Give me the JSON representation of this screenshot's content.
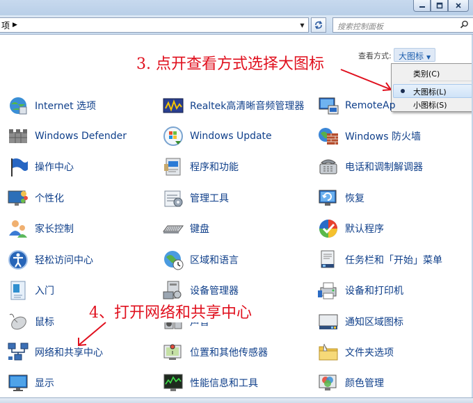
{
  "address": {
    "text": "项"
  },
  "search": {
    "placeholder": "搜索控制面板"
  },
  "view": {
    "label": "查看方式:",
    "value": "大图标"
  },
  "menu": {
    "items": [
      "类别(C)",
      "大图标(L)",
      "小图标(S)"
    ],
    "selected": "大图标(L)"
  },
  "annotations": {
    "step3": "3. 点开查看方式选择大图标",
    "step4": "4、打开网络和共享中心"
  },
  "items": [
    {
      "label": "Internet 选项",
      "icon": "internet-options-icon"
    },
    {
      "label": "Realtek高清晰音频管理器",
      "icon": "realtek-audio-icon"
    },
    {
      "label": "RemoteAp",
      "icon": "remoteapp-icon"
    },
    {
      "label": "Windows Defender",
      "icon": "windows-defender-icon"
    },
    {
      "label": "Windows Update",
      "icon": "windows-update-icon"
    },
    {
      "label": "Windows 防火墙",
      "icon": "firewall-icon"
    },
    {
      "label": "操作中心",
      "icon": "action-center-flag-icon"
    },
    {
      "label": "程序和功能",
      "icon": "programs-icon"
    },
    {
      "label": "电话和调制解调器",
      "icon": "phone-modem-icon"
    },
    {
      "label": "个性化",
      "icon": "personalization-icon"
    },
    {
      "label": "管理工具",
      "icon": "admin-tools-icon"
    },
    {
      "label": "恢复",
      "icon": "recovery-icon"
    },
    {
      "label": "家长控制",
      "icon": "parental-controls-icon"
    },
    {
      "label": "键盘",
      "icon": "keyboard-icon"
    },
    {
      "label": "默认程序",
      "icon": "default-programs-icon"
    },
    {
      "label": "轻松访问中心",
      "icon": "ease-of-access-icon"
    },
    {
      "label": "区域和语言",
      "icon": "region-language-icon"
    },
    {
      "label": "任务栏和「开始」菜单",
      "icon": "taskbar-icon"
    },
    {
      "label": "入门",
      "icon": "getting-started-icon"
    },
    {
      "label": "设备管理器",
      "icon": "device-manager-icon"
    },
    {
      "label": "设备和打印机",
      "icon": "devices-printers-icon"
    },
    {
      "label": "鼠标",
      "icon": "mouse-icon"
    },
    {
      "label": "声音",
      "icon": "sound-icon"
    },
    {
      "label": "通知区域图标",
      "icon": "notification-icons-icon"
    },
    {
      "label": "网络和共享中心",
      "icon": "network-sharing-icon"
    },
    {
      "label": "位置和其他传感器",
      "icon": "location-sensors-icon"
    },
    {
      "label": "文件夹选项",
      "icon": "folder-options-icon"
    },
    {
      "label": "显示",
      "icon": "display-icon"
    },
    {
      "label": "性能信息和工具",
      "icon": "performance-icon"
    },
    {
      "label": "颜色管理",
      "icon": "color-management-icon"
    }
  ]
}
